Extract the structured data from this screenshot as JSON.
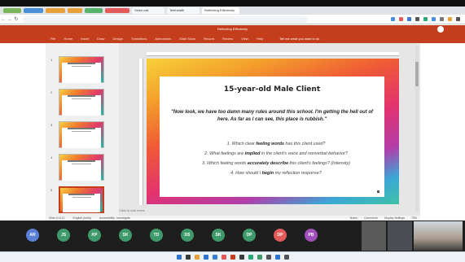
{
  "browser": {
    "bookmarks": [
      {
        "label": "",
        "color": "#7ab55c"
      },
      {
        "label": "",
        "color": "#4a90d9"
      },
      {
        "label": "",
        "color": "#e8a13a"
      },
      {
        "label": "",
        "color": "#e8a13a"
      },
      {
        "label": "",
        "color": "#56b36b"
      },
      {
        "label": "",
        "color": "#e35a5a"
      }
    ],
    "tabs": [
      {
        "label": "Video call",
        "active": false
      },
      {
        "label": "Telehealth",
        "active": false
      },
      {
        "label": "Reflecting Effectively",
        "active": true
      }
    ],
    "url": "",
    "extension_colors": [
      "#4a90d9",
      "#e35a5a",
      "#3a7bd5",
      "#555555",
      "#2aa876",
      "#4a90d9",
      "#777777",
      "#e8a13a",
      "#555555"
    ]
  },
  "powerpoint": {
    "title": "Reflecting Effectively",
    "user_name": "",
    "ribbon_tabs": [
      "File",
      "Home",
      "Insert",
      "Draw",
      "Design",
      "Transitions",
      "Animations",
      "Slide Show",
      "Record",
      "Review",
      "View",
      "Help"
    ],
    "tell_me": "Tell me what you want to do",
    "thumbnails": [
      "1",
      "2",
      "3",
      "4",
      "5"
    ],
    "selected_thumbnail": 4,
    "notes_placeholder": "Click to add notes",
    "status_left": [
      "Slide 5 of 12",
      "English (India)",
      "Accessibility: Investigate"
    ],
    "status_right": [
      "Notes",
      "Comments",
      "Display Settings",
      "73%"
    ]
  },
  "slide": {
    "title": "15-year-old Male Client",
    "quote": "\"Now look, we have too damn many rules around this school. I'm getting the hell out of here. As far as I can see, this place is rubbish.\"",
    "questions": [
      {
        "num": "1.",
        "pre": "Which clear ",
        "bold": "feeling words",
        "post": " has this client used?"
      },
      {
        "num": "2.",
        "pre": "What feelings are ",
        "bold": "implied",
        "post": " in the client's voice and nonverbal behavior?"
      },
      {
        "num": "3.",
        "pre": "Which feeling words ",
        "bold": "accurately describe",
        "post": " this client's feelings? (Intensity)"
      },
      {
        "num": "4.",
        "pre": "How should I ",
        "bold": "begin",
        "post": " my reflection response?"
      }
    ]
  },
  "call": {
    "participants": [
      {
        "initials": "AR",
        "color": "#5b7fd6"
      },
      {
        "initials": "JS",
        "color": "#3f9a6b"
      },
      {
        "initials": "KP",
        "color": "#3f9a6b"
      },
      {
        "initials": "SK",
        "color": "#3f9a6b"
      },
      {
        "initials": "TD",
        "color": "#3f9a6b"
      },
      {
        "initials": "DS",
        "color": "#3f9a6b"
      },
      {
        "initials": "SK",
        "color": "#3f9a6b"
      },
      {
        "initials": "DP",
        "color": "#3f9a6b"
      },
      {
        "initials": "DP",
        "color": "#e35a5a"
      },
      {
        "initials": "PB",
        "color": "#a04fb8"
      }
    ]
  },
  "taskbar": {
    "icon_colors": [
      "#2f74d0",
      "#3a3a3a",
      "#e8a13a",
      "#2f74d0",
      "#3a7bd5",
      "#e35a5a",
      "#c43e1c",
      "#3a3a3a",
      "#2aa876",
      "#3f9a6b",
      "#555555",
      "#2f74d0",
      "#555555"
    ],
    "time": "",
    "date": ""
  }
}
